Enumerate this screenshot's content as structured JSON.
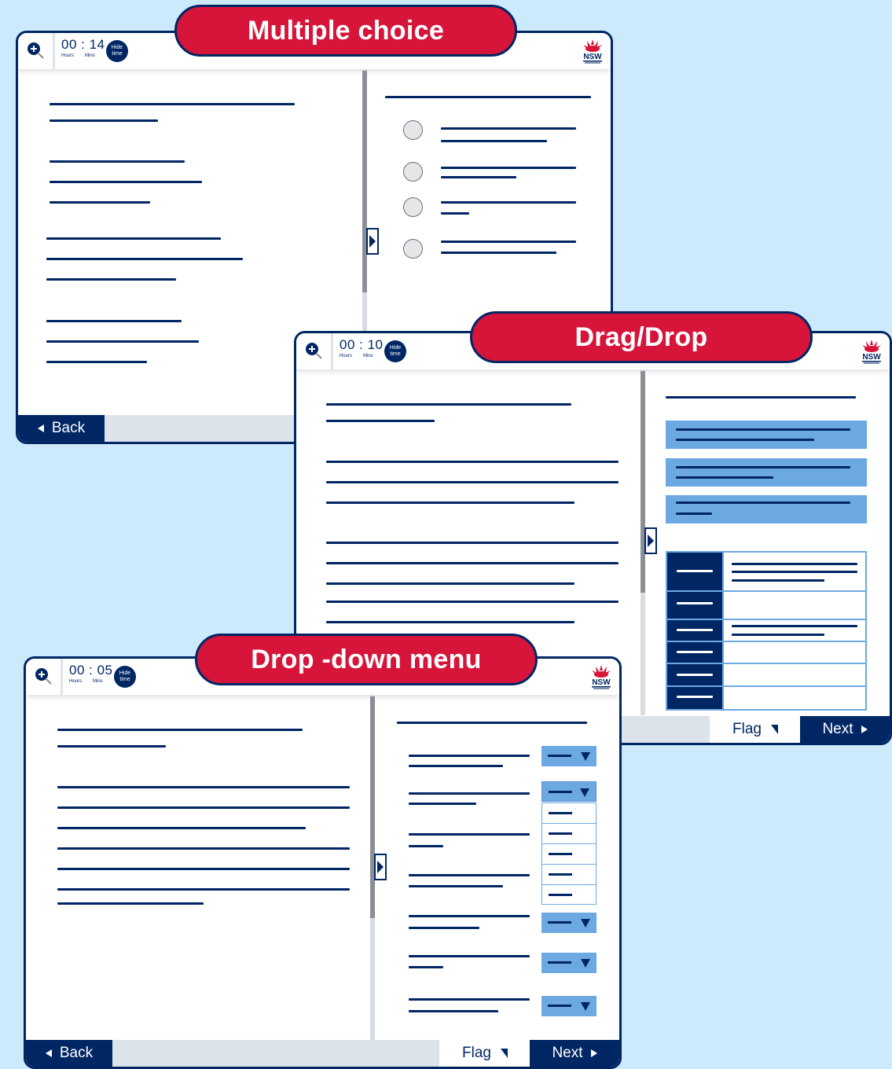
{
  "colors": {
    "navy": "#002664",
    "red": "#d7153a",
    "light_blue": "#6ca9e2",
    "background": "#cdeafc",
    "grey": "#dde3ea"
  },
  "icons": {
    "zoom": "zoom-in-magnifier-icon",
    "logo": "nsw-government-waratah-logo",
    "expand": "chevron-right-icon",
    "flag": "flag-icon"
  },
  "labels": {
    "hours": "Hours",
    "mins": "Mins",
    "hide_time": [
      "Hide",
      "time"
    ],
    "back": "Back",
    "flag": "Flag",
    "next": "Next",
    "logo_text": "NSW"
  },
  "panels": {
    "multiple_choice": {
      "title": "Multiple choice",
      "timer": "00 : 14"
    },
    "drag_drop": {
      "title": "Drag/Drop",
      "timer": "00 : 10"
    },
    "dropdown": {
      "title": "Drop -down menu",
      "timer": "00 : 05"
    }
  }
}
